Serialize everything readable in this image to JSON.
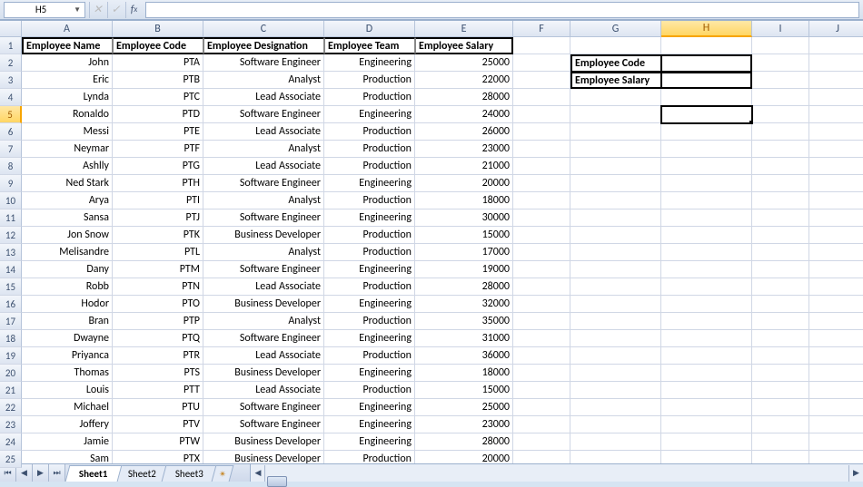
{
  "name_box": "H5",
  "formula_value": "",
  "columns": [
    "A",
    "B",
    "C",
    "D",
    "E",
    "F",
    "G",
    "H",
    "I",
    "J"
  ],
  "active_col": "H",
  "active_row": 5,
  "headers": {
    "A": "Employee Name",
    "B": "Employee Code",
    "C": "Employee Designation",
    "D": "Employee Team",
    "E": "Employee Salary"
  },
  "side_labels": {
    "G2": "Employee Code",
    "G3": "Employee Salary"
  },
  "rows": [
    {
      "name": "John",
      "code": "PTA",
      "desig": "Software Engineer",
      "team": "Engineering",
      "salary": 25000
    },
    {
      "name": "Eric",
      "code": "PTB",
      "desig": "Analyst",
      "team": "Production",
      "salary": 22000
    },
    {
      "name": "Lynda",
      "code": "PTC",
      "desig": "Lead Associate",
      "team": "Production",
      "salary": 28000
    },
    {
      "name": "Ronaldo",
      "code": "PTD",
      "desig": "Software Engineer",
      "team": "Engineering",
      "salary": 24000
    },
    {
      "name": "Messi",
      "code": "PTE",
      "desig": "Lead Associate",
      "team": "Production",
      "salary": 26000
    },
    {
      "name": "Neymar",
      "code": "PTF",
      "desig": "Analyst",
      "team": "Production",
      "salary": 23000
    },
    {
      "name": "Ashlly",
      "code": "PTG",
      "desig": "Lead Associate",
      "team": "Production",
      "salary": 21000
    },
    {
      "name": "Ned Stark",
      "code": "PTH",
      "desig": "Software Engineer",
      "team": "Engineering",
      "salary": 20000
    },
    {
      "name": "Arya",
      "code": "PTI",
      "desig": "Analyst",
      "team": "Production",
      "salary": 18000
    },
    {
      "name": "Sansa",
      "code": "PTJ",
      "desig": "Software Engineer",
      "team": "Engineering",
      "salary": 30000
    },
    {
      "name": "Jon Snow",
      "code": "PTK",
      "desig": "Business Developer",
      "team": "Production",
      "salary": 15000
    },
    {
      "name": "Melisandre",
      "code": "PTL",
      "desig": "Analyst",
      "team": "Production",
      "salary": 17000
    },
    {
      "name": "Dany",
      "code": "PTM",
      "desig": "Software Engineer",
      "team": "Engineering",
      "salary": 19000
    },
    {
      "name": "Robb",
      "code": "PTN",
      "desig": "Lead Associate",
      "team": "Production",
      "salary": 28000
    },
    {
      "name": "Hodor",
      "code": "PTO",
      "desig": "Business Developer",
      "team": "Engineering",
      "salary": 32000
    },
    {
      "name": "Bran",
      "code": "PTP",
      "desig": "Analyst",
      "team": "Production",
      "salary": 35000
    },
    {
      "name": "Dwayne",
      "code": "PTQ",
      "desig": "Software Engineer",
      "team": "Engineering",
      "salary": 31000
    },
    {
      "name": "Priyanca",
      "code": "PTR",
      "desig": "Lead Associate",
      "team": "Production",
      "salary": 36000
    },
    {
      "name": "Thomas",
      "code": "PTS",
      "desig": "Business Developer",
      "team": "Engineering",
      "salary": 18000
    },
    {
      "name": "Louis",
      "code": "PTT",
      "desig": "Lead Associate",
      "team": "Production",
      "salary": 15000
    },
    {
      "name": "Michael",
      "code": "PTU",
      "desig": "Software Engineer",
      "team": "Engineering",
      "salary": 25000
    },
    {
      "name": "Joffery",
      "code": "PTV",
      "desig": "Software Engineer",
      "team": "Engineering",
      "salary": 23000
    },
    {
      "name": "Jamie",
      "code": "PTW",
      "desig": "Business Developer",
      "team": "Engineering",
      "salary": 28000
    },
    {
      "name": "Sam",
      "code": "PTX",
      "desig": "Business Developer",
      "team": "Production",
      "salary": 20000
    }
  ],
  "sheets": [
    "Sheet1",
    "Sheet2",
    "Sheet3"
  ],
  "active_sheet": 0
}
